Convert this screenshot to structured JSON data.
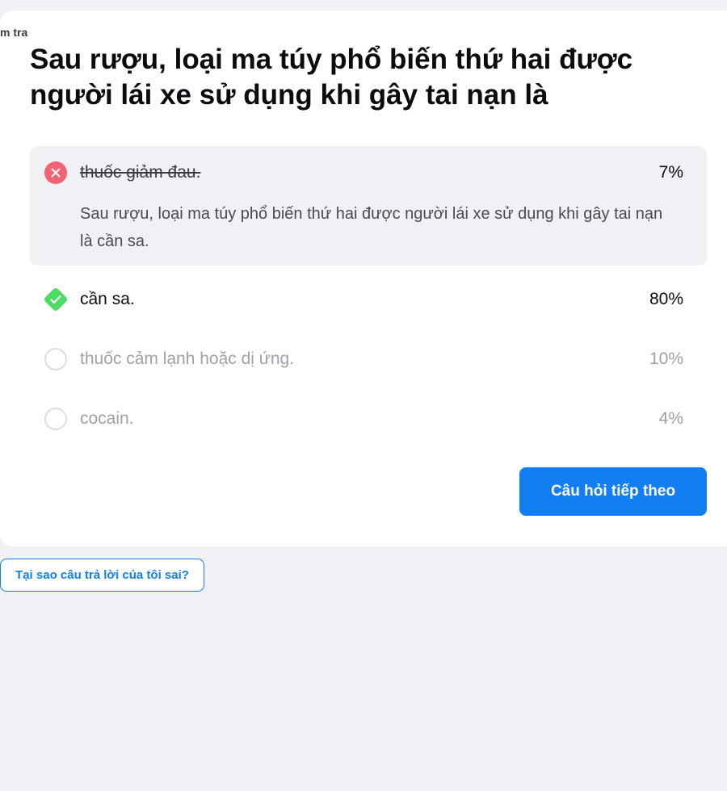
{
  "breadcrumb": "m tra",
  "question": "Sau rượu, loại ma túy phổ biến thứ hai được người lái xe sử dụng khi gây tai nạn là",
  "options": [
    {
      "label": "thuốc giảm đau.",
      "percent": "7%",
      "state": "wrong",
      "icon": "x-icon"
    },
    {
      "label": "cần sa.",
      "percent": "80%",
      "state": "correct",
      "icon": "check-icon"
    },
    {
      "label": "thuốc cảm lạnh hoặc dị ứng.",
      "percent": "10%",
      "state": "unselected",
      "icon": "radio-empty-icon"
    },
    {
      "label": "cocain.",
      "percent": "4%",
      "state": "unselected",
      "icon": "radio-empty-icon"
    }
  ],
  "explanation": "Sau rượu, loại ma túy phổ biến thứ hai được người lái xe sử dụng khi gây tai nạn là cần sa.",
  "next_button": "Câu hỏi tiếp theo",
  "why_button": "Tại sao câu trả lời của tôi sai?",
  "colors": {
    "accent": "#117ff3",
    "wrong": "#f36274",
    "correct": "#4cdc62",
    "muted_text": "#a0a0a8"
  }
}
